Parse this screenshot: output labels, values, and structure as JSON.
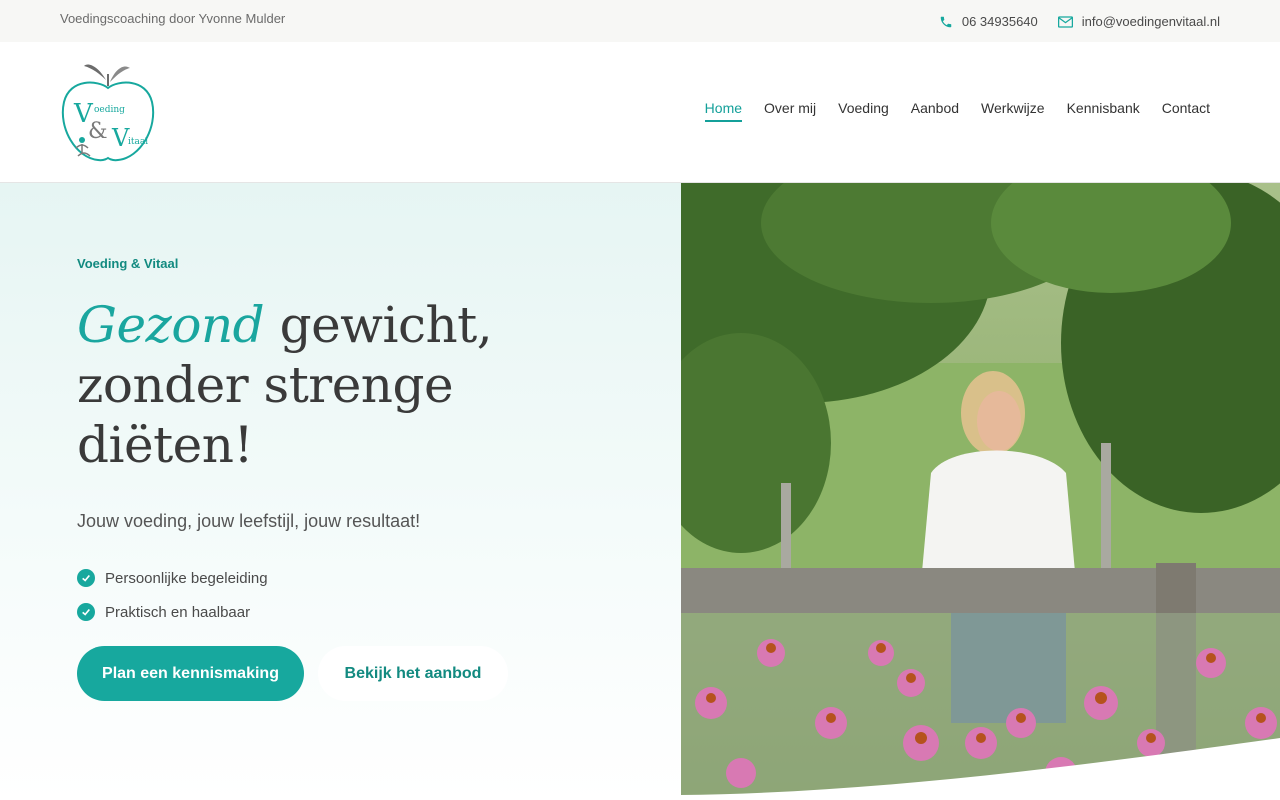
{
  "topbar": {
    "tagline": "Voedingscoaching door Yvonne Mulder",
    "phone": "06 34935640",
    "email": "info@voedingenvitaal.nl"
  },
  "logo": {
    "big_v": "V",
    "oeding": "oeding",
    "amp": "&",
    "big_v2": "V",
    "itaal": "itaal"
  },
  "nav": {
    "items": [
      "Home",
      "Over mij",
      "Voeding",
      "Aanbod",
      "Werkwijze",
      "Kennisbank",
      "Contact"
    ],
    "active": "Home"
  },
  "hero": {
    "eyebrow": "Voeding & Vitaal",
    "headline_accent": "Gezond",
    "headline_rest_1": " gewicht,",
    "headline_rest_2": "zonder strenge",
    "headline_rest_3": "diëten!",
    "subline": "Jouw voeding, jouw leefstijl, jouw resultaat!",
    "benefits": [
      "Persoonlijke begeleiding",
      "Praktisch en haalbaar"
    ],
    "cta_primary": "Plan een kennismaking",
    "cta_secondary": "Bekijk het aanbod"
  },
  "colors": {
    "accent": "#17a89e",
    "accent_dark": "#128a80",
    "topbar_bg": "#f7f7f5"
  },
  "icons": {
    "phone": "phone-icon",
    "email": "envelope-icon",
    "check": "check-circle-icon"
  }
}
